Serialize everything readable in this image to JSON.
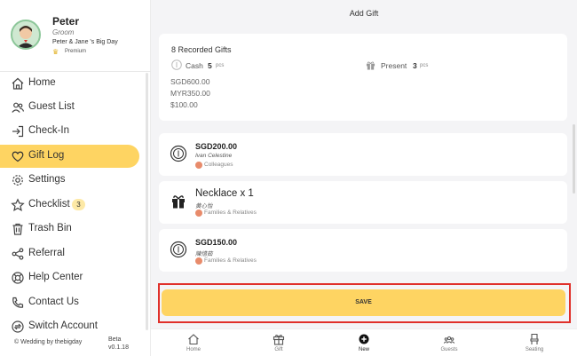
{
  "profile": {
    "name": "Peter",
    "role": "Groom",
    "event": "Peter & Jane 's Big Day",
    "tier": "Premium"
  },
  "nav": {
    "items": [
      {
        "label": "Home",
        "icon": "home-icon"
      },
      {
        "label": "Guest List",
        "icon": "guests-icon"
      },
      {
        "label": "Check-In",
        "icon": "check-in-icon"
      },
      {
        "label": "Gift Log",
        "icon": "heart-icon",
        "active": true
      },
      {
        "label": "Settings",
        "icon": "gear-icon"
      },
      {
        "label": "Checklist",
        "icon": "star-icon",
        "badge": "3"
      },
      {
        "label": "Trash Bin",
        "icon": "trash-icon"
      },
      {
        "label": "Referral",
        "icon": "share-icon"
      },
      {
        "label": "Help Center",
        "icon": "lifebuoy-icon"
      },
      {
        "label": "Contact Us",
        "icon": "phone-icon"
      },
      {
        "label": "Switch Account",
        "icon": "switch-icon"
      }
    ]
  },
  "footer": {
    "copyright": "© Wedding by thebigday",
    "beta": "Beta",
    "version": "v0.1.18"
  },
  "header": {
    "title": "Add Gift"
  },
  "summary": {
    "title": "8 Recorded Gifts",
    "cash_label": "Cash",
    "cash_count": "5",
    "present_label": "Present",
    "present_count": "3",
    "unit": "pcs",
    "amounts": [
      "SGD600.00",
      "MYR350.00",
      "$100.00"
    ]
  },
  "gifts": [
    {
      "type": "cash",
      "amount": "SGD200.00",
      "name": "Ivan Celestine",
      "group": "Colleagues"
    },
    {
      "type": "present",
      "title": "Necklace x 1",
      "name": "黄心怡",
      "group": "Families & Relatives"
    },
    {
      "type": "cash",
      "amount": "SGD150.00",
      "name": "陳惜茹",
      "group": "Families & Relatives"
    }
  ],
  "save_label": "SAVE",
  "tabs": [
    {
      "label": "Home",
      "icon": "home-icon"
    },
    {
      "label": "Gift",
      "icon": "gift-icon"
    },
    {
      "label": "New",
      "icon": "plus-circle-icon",
      "active": true
    },
    {
      "label": "Guests",
      "icon": "group-icon"
    },
    {
      "label": "Seating",
      "icon": "chair-icon"
    }
  ],
  "colors": {
    "accent": "#fed462",
    "highlight_border": "#e0302a",
    "background": "#f4f4f6"
  }
}
